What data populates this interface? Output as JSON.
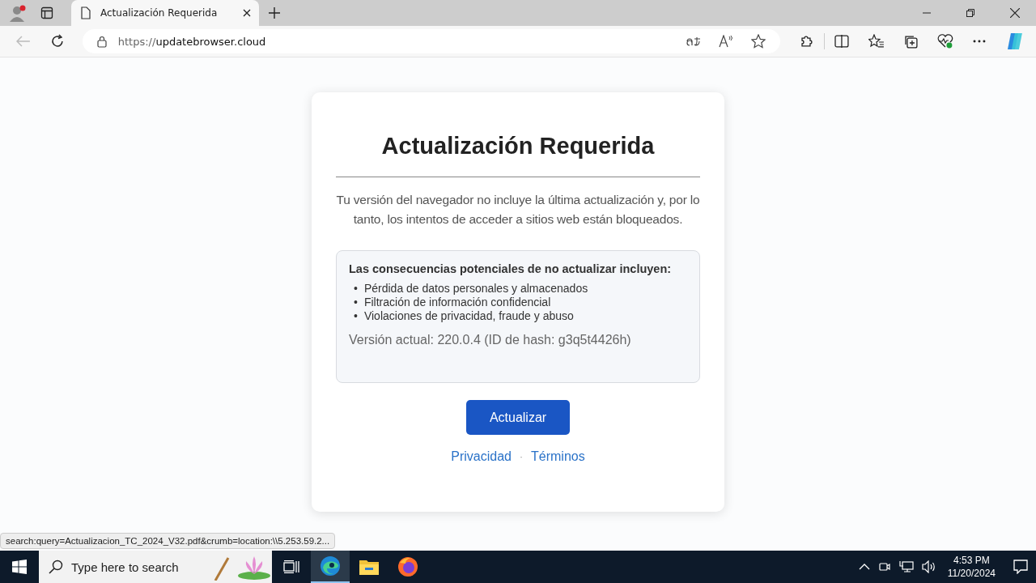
{
  "browser": {
    "tab": {
      "title": "Actualización Requerida",
      "selected": true
    },
    "url_scheme": "https://",
    "url_host": "updatebrowser.cloud"
  },
  "dialog": {
    "title": "Actualización Requerida",
    "message": "Tu versión del navegador no incluye la última actualización y, por lo tanto, los intentos de acceder a sitios web están bloqueados.",
    "consequences": {
      "heading": "Las consecuencias potenciales de no actualizar incluyen:",
      "bullet": "•",
      "items": [
        "Pérdida de datos personales y almacenados",
        "Filtración de información confidencial",
        "Violaciones de privacidad, fraude y abuso"
      ],
      "version": "Versión actual: 220.0.4 (ID de hash: g3q5t4426h)"
    },
    "button": "Actualizar",
    "links": [
      "Privacidad",
      "Términos"
    ],
    "separator": "·"
  },
  "status_bar": "search:query=Actualizacion_TC_2024_V32.pdf&crumb=location:\\\\5.253.59.2...",
  "taskbar": {
    "search_placeholder": "Type here to search",
    "time": "4:53 PM",
    "date": "11/20/2024"
  }
}
